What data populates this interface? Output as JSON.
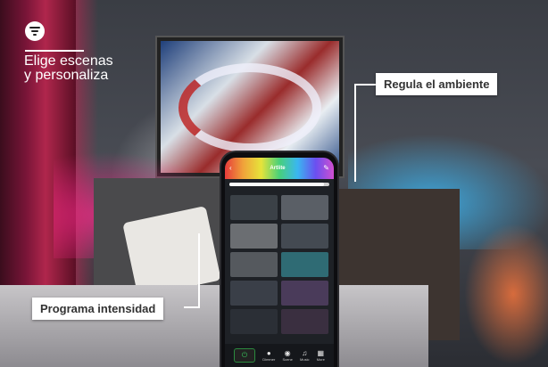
{
  "branding": {
    "icon": "filter-menu-icon"
  },
  "headline": {
    "line1": "Elige escenas",
    "line2": "y personaliza"
  },
  "callouts": {
    "right": "Regula el ambiente",
    "left": "Programa intensidad"
  },
  "app": {
    "title": "Artlite",
    "brightness_level": 0.95,
    "tiles": [
      {
        "color": "#3b4147"
      },
      {
        "color": "#5a5f66"
      },
      {
        "color": "#6b6e72"
      },
      {
        "color": "#444a52"
      },
      {
        "color": "#55595e"
      },
      {
        "color": "#2f6b74"
      },
      {
        "color": "#3a3f48"
      },
      {
        "color": "#4a3b5a"
      },
      {
        "color": "#2b2f36"
      },
      {
        "color": "#3a2f40"
      }
    ],
    "tabs": [
      {
        "icon": "bulb-icon",
        "label": "Dimmer"
      },
      {
        "icon": "scene-icon",
        "label": "Scene"
      },
      {
        "icon": "music-icon",
        "label": "Music"
      },
      {
        "icon": "more-icon",
        "label": "More"
      }
    ]
  }
}
